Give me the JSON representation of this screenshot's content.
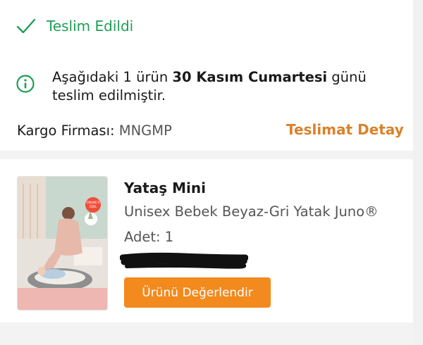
{
  "status": {
    "icon": "checkmark-icon",
    "label": "Teslim Edildi",
    "color": "#1e9e55"
  },
  "info": {
    "icon": "info-circle-icon",
    "text_part1": "Aşağıdaki 1 ürün ",
    "date_bold": "30 Kasım Cumartesi",
    "text_part2": " günü teslim edilmiştir."
  },
  "cargo": {
    "label": "Kargo Firması:",
    "value": "MNGMP"
  },
  "delivery_detail_link": "Teslimat Detay",
  "product": {
    "badge_line1": "ONLINE'A",
    "badge_line2": "ÖZEL",
    "brand": "Yataş Mini",
    "name": "Unisex Bebek Beyaz-Gri Yatak Juno®",
    "quantity_label": "Adet:",
    "quantity": "1",
    "review_button": "Ürünü Değerlendir"
  },
  "colors": {
    "accent_orange": "#f28a1e",
    "link_orange": "#d9822b",
    "success_green": "#1e9e55"
  }
}
